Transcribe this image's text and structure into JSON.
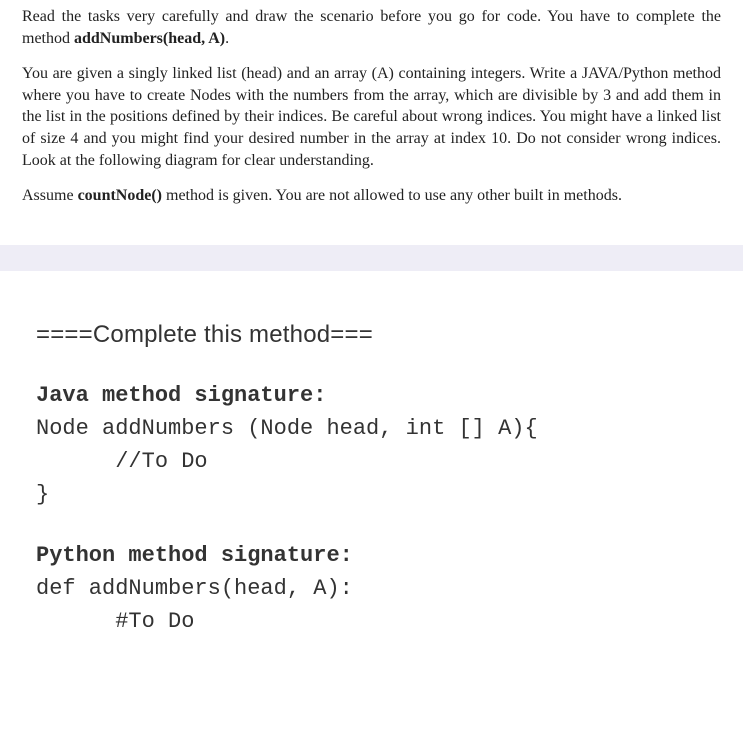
{
  "instructions": {
    "p1_prefix": "Read the tasks very carefully and draw the scenario before you go for code. You have to complete the method ",
    "p1_bold": "addNumbers(head, A)",
    "p1_suffix": ".",
    "p2": "You are given a singly linked list (head) and an array (A) containing integers. Write a JAVA/Python method where you have to create Nodes with the numbers from the array, which are divisible by 3 and add them in the list in the positions defined by their indices. Be careful about wrong indices. You might have a linked list of size 4 and you might find your desired number in the array at index 10. Do not consider wrong indices. Look at the following diagram for clear understanding.",
    "p3_prefix": "Assume ",
    "p3_bold": "countNode()",
    "p3_suffix": " method is given. You are not allowed to use any other built in methods."
  },
  "code": {
    "heading": "====Complete this method===",
    "java_title": "Java method signature:",
    "java_line1": "Node addNumbers (Node head, int [] A){",
    "java_line2": "      //To Do",
    "java_line3": "}",
    "python_title": "Python method signature:",
    "python_line1": "def addNumbers(head, A):",
    "python_line2": "      #To Do"
  }
}
